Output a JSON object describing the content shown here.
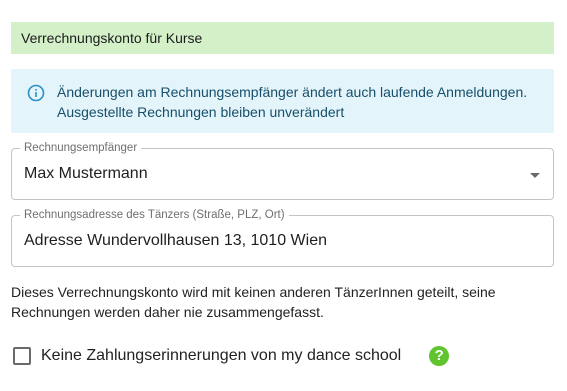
{
  "section": {
    "title": "Verrechnungskonto für Kurse"
  },
  "info": {
    "icon": "info-icon",
    "line1": "Änderungen am Rechnungsempfänger ändert auch laufende Anmeldungen.",
    "line2": "Ausgestellte Rechnungen bleiben unverändert",
    "color": "#174f6a",
    "background": "#e3f4fb"
  },
  "recipient": {
    "label": "Rechnungsempfänger",
    "value": "Max Mustermann",
    "icon": "chevron-down-icon"
  },
  "address": {
    "label": "Rechnungsadresse des Tänzers (Straße, PLZ, Ort)",
    "value": "Adresse Wundervollhausen 13, 1010 Wien"
  },
  "note": {
    "line1": "Dieses Verrechnungskonto wird mit keinen anderen TänzerInnen geteilt, seine",
    "line2": "Rechnungen werden daher nie zusammengefasst."
  },
  "reminders": {
    "label": "Keine Zahlungserinnerungen von my dance school",
    "checked": false,
    "help_symbol": "?",
    "help_color": "#5fc42d"
  },
  "colors": {
    "header_bg": "#d4f0c8"
  }
}
